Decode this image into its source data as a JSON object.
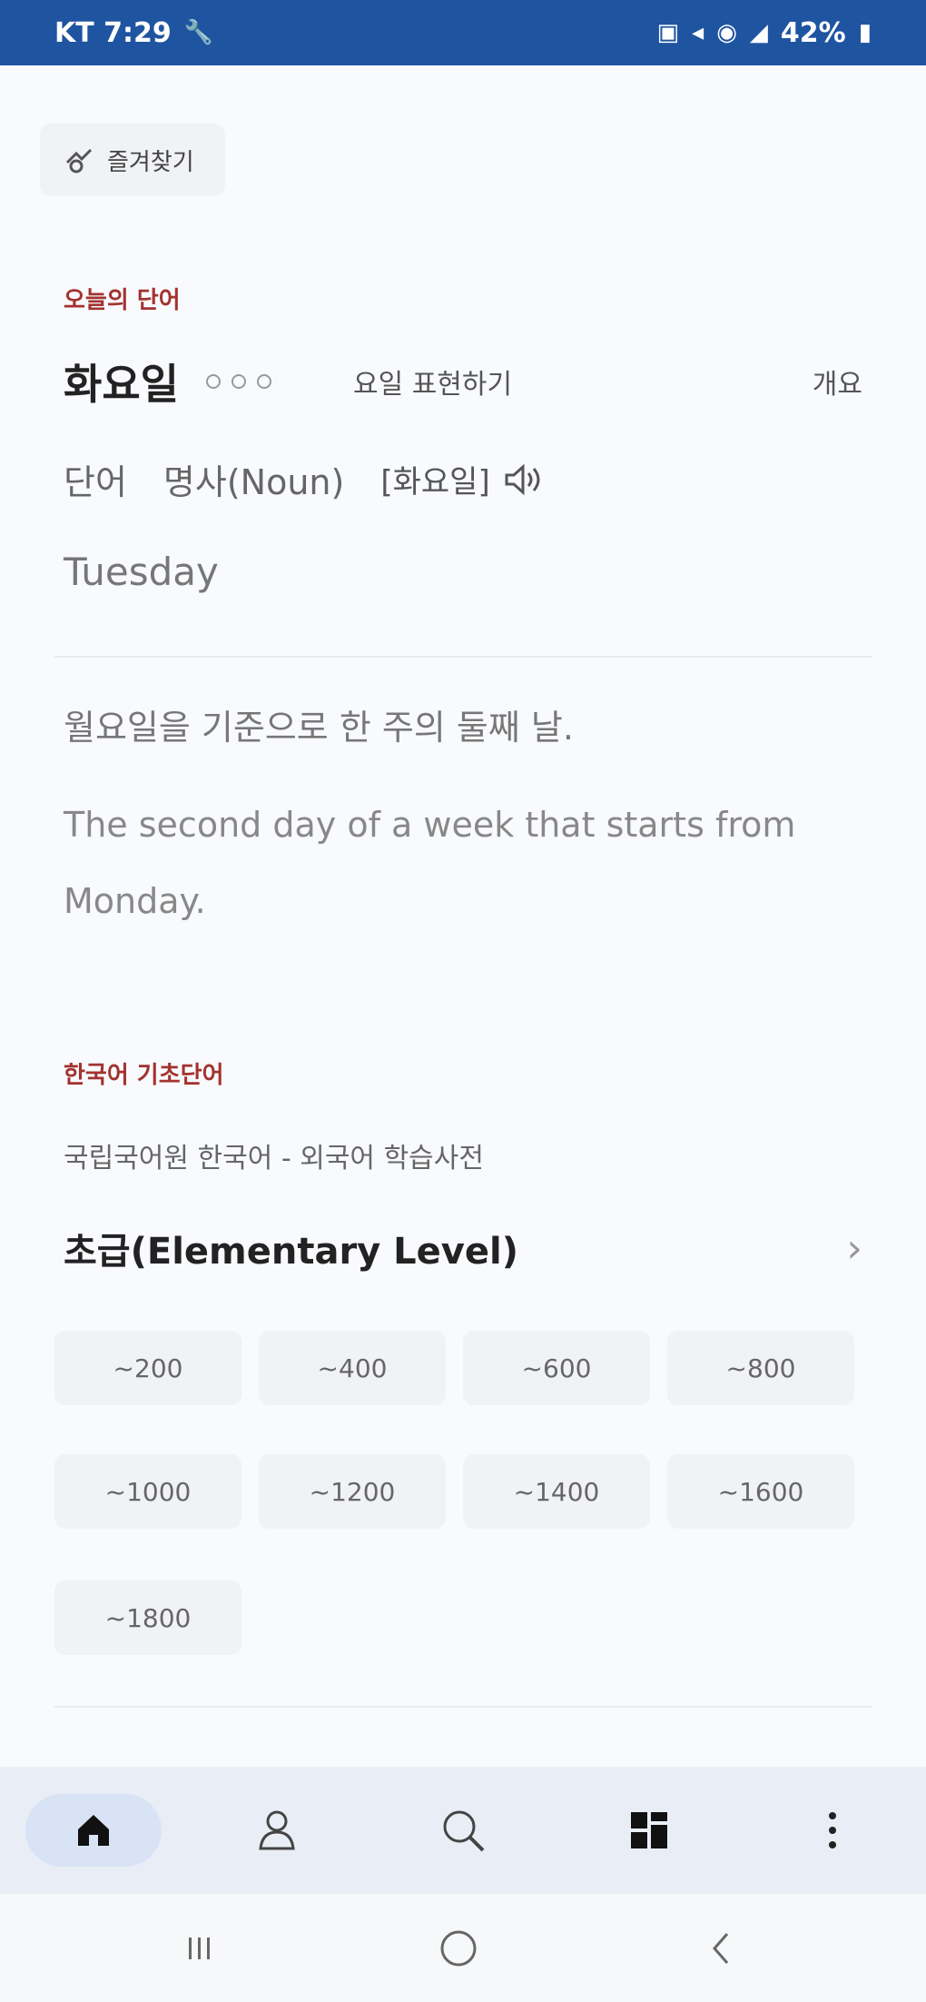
{
  "status_bar": {
    "carrier_time": "KT 7:29",
    "battery": "42%"
  },
  "favorites_chip": {
    "label": "즐겨찾기"
  },
  "word_of_day": {
    "section_label": "오늘의 단어",
    "word": "화요일",
    "related_link": "요일 표현하기",
    "more_label": "개요",
    "type_label": "단어",
    "pos": "명사(Noun)",
    "pronunciation": "[화요일]",
    "english": "Tuesday",
    "definition_ko": "월요일을 기준으로 한 주의 둘째 날.",
    "definition_en": "The second day of a week that starts from Monday."
  },
  "basic_vocab": {
    "section_label": "한국어 기초단어",
    "source": "국립국어원 한국어 - 외국어 학습사전",
    "level_title": "초급(Elementary Level)",
    "ranges": [
      "~200",
      "~400",
      "~600",
      "~800",
      "~1000",
      "~1200",
      "~1400",
      "~1600",
      "~1800"
    ]
  },
  "colors": {
    "status_bar": "#1f54a1",
    "accent_label": "#a3322f",
    "nav_bg": "#e9eef6",
    "nav_active": "#d9e3f6"
  },
  "icons": {
    "nav": [
      "home-icon",
      "person-icon",
      "search-icon",
      "grid-icon",
      "more-vertical-icon"
    ],
    "system": [
      "recent-apps-icon",
      "home-circle-icon",
      "back-icon"
    ]
  }
}
